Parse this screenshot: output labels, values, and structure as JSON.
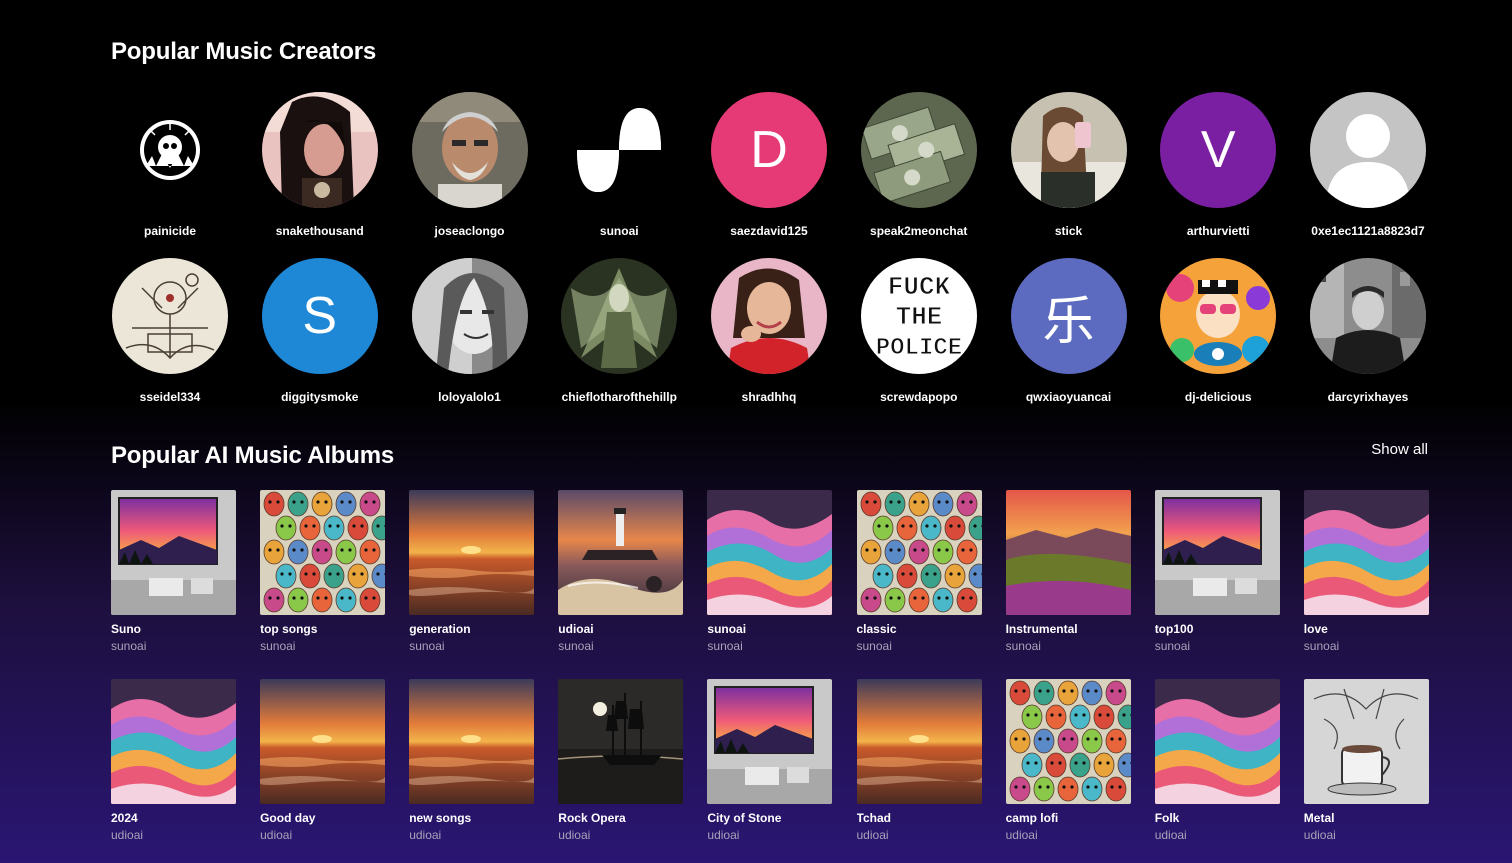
{
  "creators_section": {
    "title": "Popular Music Creators",
    "creators": [
      {
        "name": "painicide",
        "avatar": "skull-badge-icon"
      },
      {
        "name": "snakethousand",
        "avatar": "photo"
      },
      {
        "name": "joseaclongo",
        "avatar": "photo"
      },
      {
        "name": "sunoai",
        "avatar": "wave-logo-icon"
      },
      {
        "name": "saezdavid125",
        "avatar": "letter",
        "letter": "D",
        "color": "#e53a76"
      },
      {
        "name": "speak2meonchat",
        "avatar": "photo"
      },
      {
        "name": "stick",
        "avatar": "photo"
      },
      {
        "name": "arthurvietti",
        "avatar": "letter",
        "letter": "V",
        "color": "#7b1fa2"
      },
      {
        "name": "0xe1ec1121a8823d7",
        "avatar": "default-user-icon"
      },
      {
        "name": "sseidel334",
        "avatar": "photo"
      },
      {
        "name": "diggitysmoke",
        "avatar": "letter",
        "letter": "S",
        "color": "#1e88d6"
      },
      {
        "name": "loloyalolo1",
        "avatar": "photo"
      },
      {
        "name": "chieflotharofthehillp",
        "avatar": "photo"
      },
      {
        "name": "shradhhq",
        "avatar": "photo"
      },
      {
        "name": "screwdapopo",
        "avatar": "text-badge",
        "badge_text": [
          "FUCK",
          "THE",
          "POLICE"
        ]
      },
      {
        "name": "qwxiaoyuancai",
        "avatar": "letter",
        "letter": "乐",
        "color": "#5c6bc0"
      },
      {
        "name": "dj-delicious",
        "avatar": "photo"
      },
      {
        "name": "darcyrixhayes",
        "avatar": "photo"
      }
    ]
  },
  "albums_section": {
    "title": "Popular AI Music Albums",
    "show_all_label": "Show all",
    "albums": [
      {
        "title": "Suno",
        "artist": "sunoai",
        "cover": "room-sunset"
      },
      {
        "title": "top songs",
        "artist": "sunoai",
        "cover": "masks"
      },
      {
        "title": "generation",
        "artist": "sunoai",
        "cover": "ocean-sunset"
      },
      {
        "title": "udioai",
        "artist": "sunoai",
        "cover": "lighthouse"
      },
      {
        "title": "sunoai",
        "artist": "sunoai",
        "cover": "waves"
      },
      {
        "title": "classic",
        "artist": "sunoai",
        "cover": "masks"
      },
      {
        "title": "Instrumental",
        "artist": "sunoai",
        "cover": "valley"
      },
      {
        "title": "top100",
        "artist": "sunoai",
        "cover": "room-sunset"
      },
      {
        "title": "love",
        "artist": "sunoai",
        "cover": "waves"
      },
      {
        "title": "2024",
        "artist": "udioai",
        "cover": "waves"
      },
      {
        "title": "Good day",
        "artist": "udioai",
        "cover": "ocean-sunset"
      },
      {
        "title": "new songs",
        "artist": "udioai",
        "cover": "ocean-sunset"
      },
      {
        "title": "Rock Opera",
        "artist": "udioai",
        "cover": "ship"
      },
      {
        "title": "City of Stone",
        "artist": "udioai",
        "cover": "room-sunset"
      },
      {
        "title": "Tchad",
        "artist": "udioai",
        "cover": "ocean-sunset"
      },
      {
        "title": "camp lofi",
        "artist": "udioai",
        "cover": "masks"
      },
      {
        "title": "Folk",
        "artist": "udioai",
        "cover": "waves"
      },
      {
        "title": "Metal",
        "artist": "udioai",
        "cover": "coffee-sketch"
      }
    ]
  }
}
